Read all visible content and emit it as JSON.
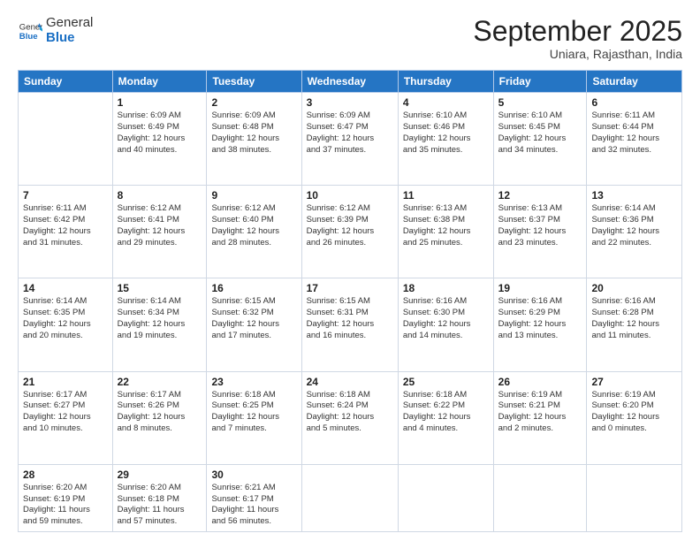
{
  "logo": {
    "general": "General",
    "blue": "Blue"
  },
  "title": "September 2025",
  "subtitle": "Uniara, Rajasthan, India",
  "days": [
    "Sunday",
    "Monday",
    "Tuesday",
    "Wednesday",
    "Thursday",
    "Friday",
    "Saturday"
  ],
  "weeks": [
    [
      {
        "date": "",
        "info": ""
      },
      {
        "date": "1",
        "info": "Sunrise: 6:09 AM\nSunset: 6:49 PM\nDaylight: 12 hours\nand 40 minutes."
      },
      {
        "date": "2",
        "info": "Sunrise: 6:09 AM\nSunset: 6:48 PM\nDaylight: 12 hours\nand 38 minutes."
      },
      {
        "date": "3",
        "info": "Sunrise: 6:09 AM\nSunset: 6:47 PM\nDaylight: 12 hours\nand 37 minutes."
      },
      {
        "date": "4",
        "info": "Sunrise: 6:10 AM\nSunset: 6:46 PM\nDaylight: 12 hours\nand 35 minutes."
      },
      {
        "date": "5",
        "info": "Sunrise: 6:10 AM\nSunset: 6:45 PM\nDaylight: 12 hours\nand 34 minutes."
      },
      {
        "date": "6",
        "info": "Sunrise: 6:11 AM\nSunset: 6:44 PM\nDaylight: 12 hours\nand 32 minutes."
      }
    ],
    [
      {
        "date": "7",
        "info": "Sunrise: 6:11 AM\nSunset: 6:42 PM\nDaylight: 12 hours\nand 31 minutes."
      },
      {
        "date": "8",
        "info": "Sunrise: 6:12 AM\nSunset: 6:41 PM\nDaylight: 12 hours\nand 29 minutes."
      },
      {
        "date": "9",
        "info": "Sunrise: 6:12 AM\nSunset: 6:40 PM\nDaylight: 12 hours\nand 28 minutes."
      },
      {
        "date": "10",
        "info": "Sunrise: 6:12 AM\nSunset: 6:39 PM\nDaylight: 12 hours\nand 26 minutes."
      },
      {
        "date": "11",
        "info": "Sunrise: 6:13 AM\nSunset: 6:38 PM\nDaylight: 12 hours\nand 25 minutes."
      },
      {
        "date": "12",
        "info": "Sunrise: 6:13 AM\nSunset: 6:37 PM\nDaylight: 12 hours\nand 23 minutes."
      },
      {
        "date": "13",
        "info": "Sunrise: 6:14 AM\nSunset: 6:36 PM\nDaylight: 12 hours\nand 22 minutes."
      }
    ],
    [
      {
        "date": "14",
        "info": "Sunrise: 6:14 AM\nSunset: 6:35 PM\nDaylight: 12 hours\nand 20 minutes."
      },
      {
        "date": "15",
        "info": "Sunrise: 6:14 AM\nSunset: 6:34 PM\nDaylight: 12 hours\nand 19 minutes."
      },
      {
        "date": "16",
        "info": "Sunrise: 6:15 AM\nSunset: 6:32 PM\nDaylight: 12 hours\nand 17 minutes."
      },
      {
        "date": "17",
        "info": "Sunrise: 6:15 AM\nSunset: 6:31 PM\nDaylight: 12 hours\nand 16 minutes."
      },
      {
        "date": "18",
        "info": "Sunrise: 6:16 AM\nSunset: 6:30 PM\nDaylight: 12 hours\nand 14 minutes."
      },
      {
        "date": "19",
        "info": "Sunrise: 6:16 AM\nSunset: 6:29 PM\nDaylight: 12 hours\nand 13 minutes."
      },
      {
        "date": "20",
        "info": "Sunrise: 6:16 AM\nSunset: 6:28 PM\nDaylight: 12 hours\nand 11 minutes."
      }
    ],
    [
      {
        "date": "21",
        "info": "Sunrise: 6:17 AM\nSunset: 6:27 PM\nDaylight: 12 hours\nand 10 minutes."
      },
      {
        "date": "22",
        "info": "Sunrise: 6:17 AM\nSunset: 6:26 PM\nDaylight: 12 hours\nand 8 minutes."
      },
      {
        "date": "23",
        "info": "Sunrise: 6:18 AM\nSunset: 6:25 PM\nDaylight: 12 hours\nand 7 minutes."
      },
      {
        "date": "24",
        "info": "Sunrise: 6:18 AM\nSunset: 6:24 PM\nDaylight: 12 hours\nand 5 minutes."
      },
      {
        "date": "25",
        "info": "Sunrise: 6:18 AM\nSunset: 6:22 PM\nDaylight: 12 hours\nand 4 minutes."
      },
      {
        "date": "26",
        "info": "Sunrise: 6:19 AM\nSunset: 6:21 PM\nDaylight: 12 hours\nand 2 minutes."
      },
      {
        "date": "27",
        "info": "Sunrise: 6:19 AM\nSunset: 6:20 PM\nDaylight: 12 hours\nand 0 minutes."
      }
    ],
    [
      {
        "date": "28",
        "info": "Sunrise: 6:20 AM\nSunset: 6:19 PM\nDaylight: 11 hours\nand 59 minutes."
      },
      {
        "date": "29",
        "info": "Sunrise: 6:20 AM\nSunset: 6:18 PM\nDaylight: 11 hours\nand 57 minutes."
      },
      {
        "date": "30",
        "info": "Sunrise: 6:21 AM\nSunset: 6:17 PM\nDaylight: 11 hours\nand 56 minutes."
      },
      {
        "date": "",
        "info": ""
      },
      {
        "date": "",
        "info": ""
      },
      {
        "date": "",
        "info": ""
      },
      {
        "date": "",
        "info": ""
      }
    ]
  ]
}
